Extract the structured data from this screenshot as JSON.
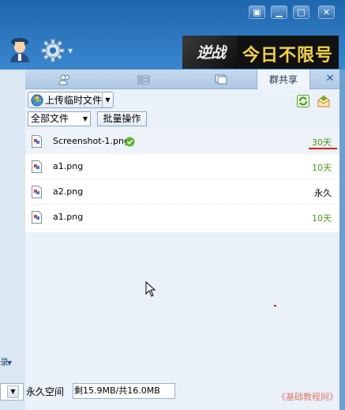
{
  "window": {
    "buttons": [
      {
        "name": "menu-button",
        "glyph": "▣"
      },
      {
        "name": "minimize-button",
        "glyph": "▁"
      },
      {
        "name": "maximize-button",
        "glyph": "□"
      },
      {
        "name": "close-button",
        "glyph": "✕"
      }
    ]
  },
  "banner": {
    "logo": "逆战",
    "slogan": "今日不限号"
  },
  "tabs": {
    "group_share_label": "群共享"
  },
  "toolbar": {
    "upload_label": "上传临时文件",
    "filter_value": "全部文件",
    "batch_label": "批量操作"
  },
  "files": [
    {
      "name": "Screenshot-1.png",
      "expiry": "30天",
      "verified": true
    },
    {
      "name": "a1.png",
      "expiry": "10天",
      "verified": false
    },
    {
      "name": "a2.png",
      "expiry": "永久",
      "verified": false
    },
    {
      "name": "a1.png",
      "expiry": "10天",
      "verified": false
    }
  ],
  "footer": {
    "space_label": "永久空间",
    "space_value": "剩15.9MB/共16.0MB"
  },
  "left_panel": {
    "fragment": "录"
  },
  "watermark": "《基础教程网》",
  "colors": {
    "accent": "#2a72b8",
    "expiry_green": "#4a9a1c",
    "underline_red": "#e01818"
  }
}
